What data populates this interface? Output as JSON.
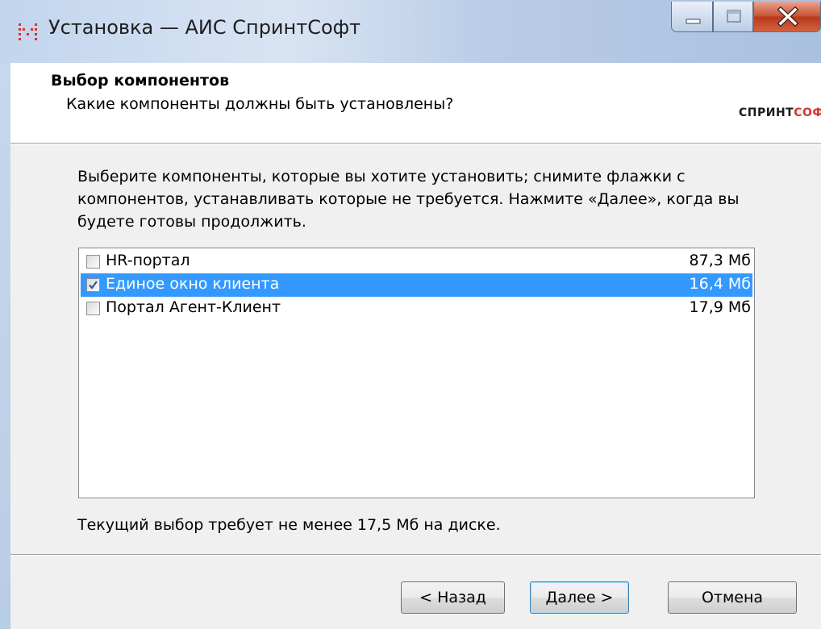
{
  "window": {
    "title": "Установка — АИС СпринтСофт",
    "accent_color": "#d6342f"
  },
  "header": {
    "title": "Выбор компонентов",
    "subtitle": "Какие компоненты должны быть установлены?",
    "logo_part1": "СПРИНТ",
    "logo_part2": "СОФТ"
  },
  "main": {
    "description": "Выберите компоненты, которые вы хотите установить; снимите флажки с компонентов, устанавливать которые не требуется. Нажмите «Далее», когда вы будете готовы продолжить.",
    "components": [
      {
        "label": "HR-портал",
        "size": "87,3 Мб",
        "checked": false,
        "selected": false
      },
      {
        "label": "Единое окно клиента",
        "size": "16,4 Мб",
        "checked": true,
        "selected": true
      },
      {
        "label": "Портал Агент-Клиент",
        "size": "17,9 Мб",
        "checked": false,
        "selected": false
      }
    ],
    "space_info": "Текущий выбор требует не менее 17,5 Мб на диске."
  },
  "buttons": {
    "back": "< Назад",
    "next": "Далее >",
    "cancel": "Отмена"
  },
  "icons": {
    "app": "installer-app-icon",
    "minimize": "minimize-icon",
    "maximize": "maximize-icon",
    "close": "close-icon",
    "check": "checkmark-icon"
  }
}
